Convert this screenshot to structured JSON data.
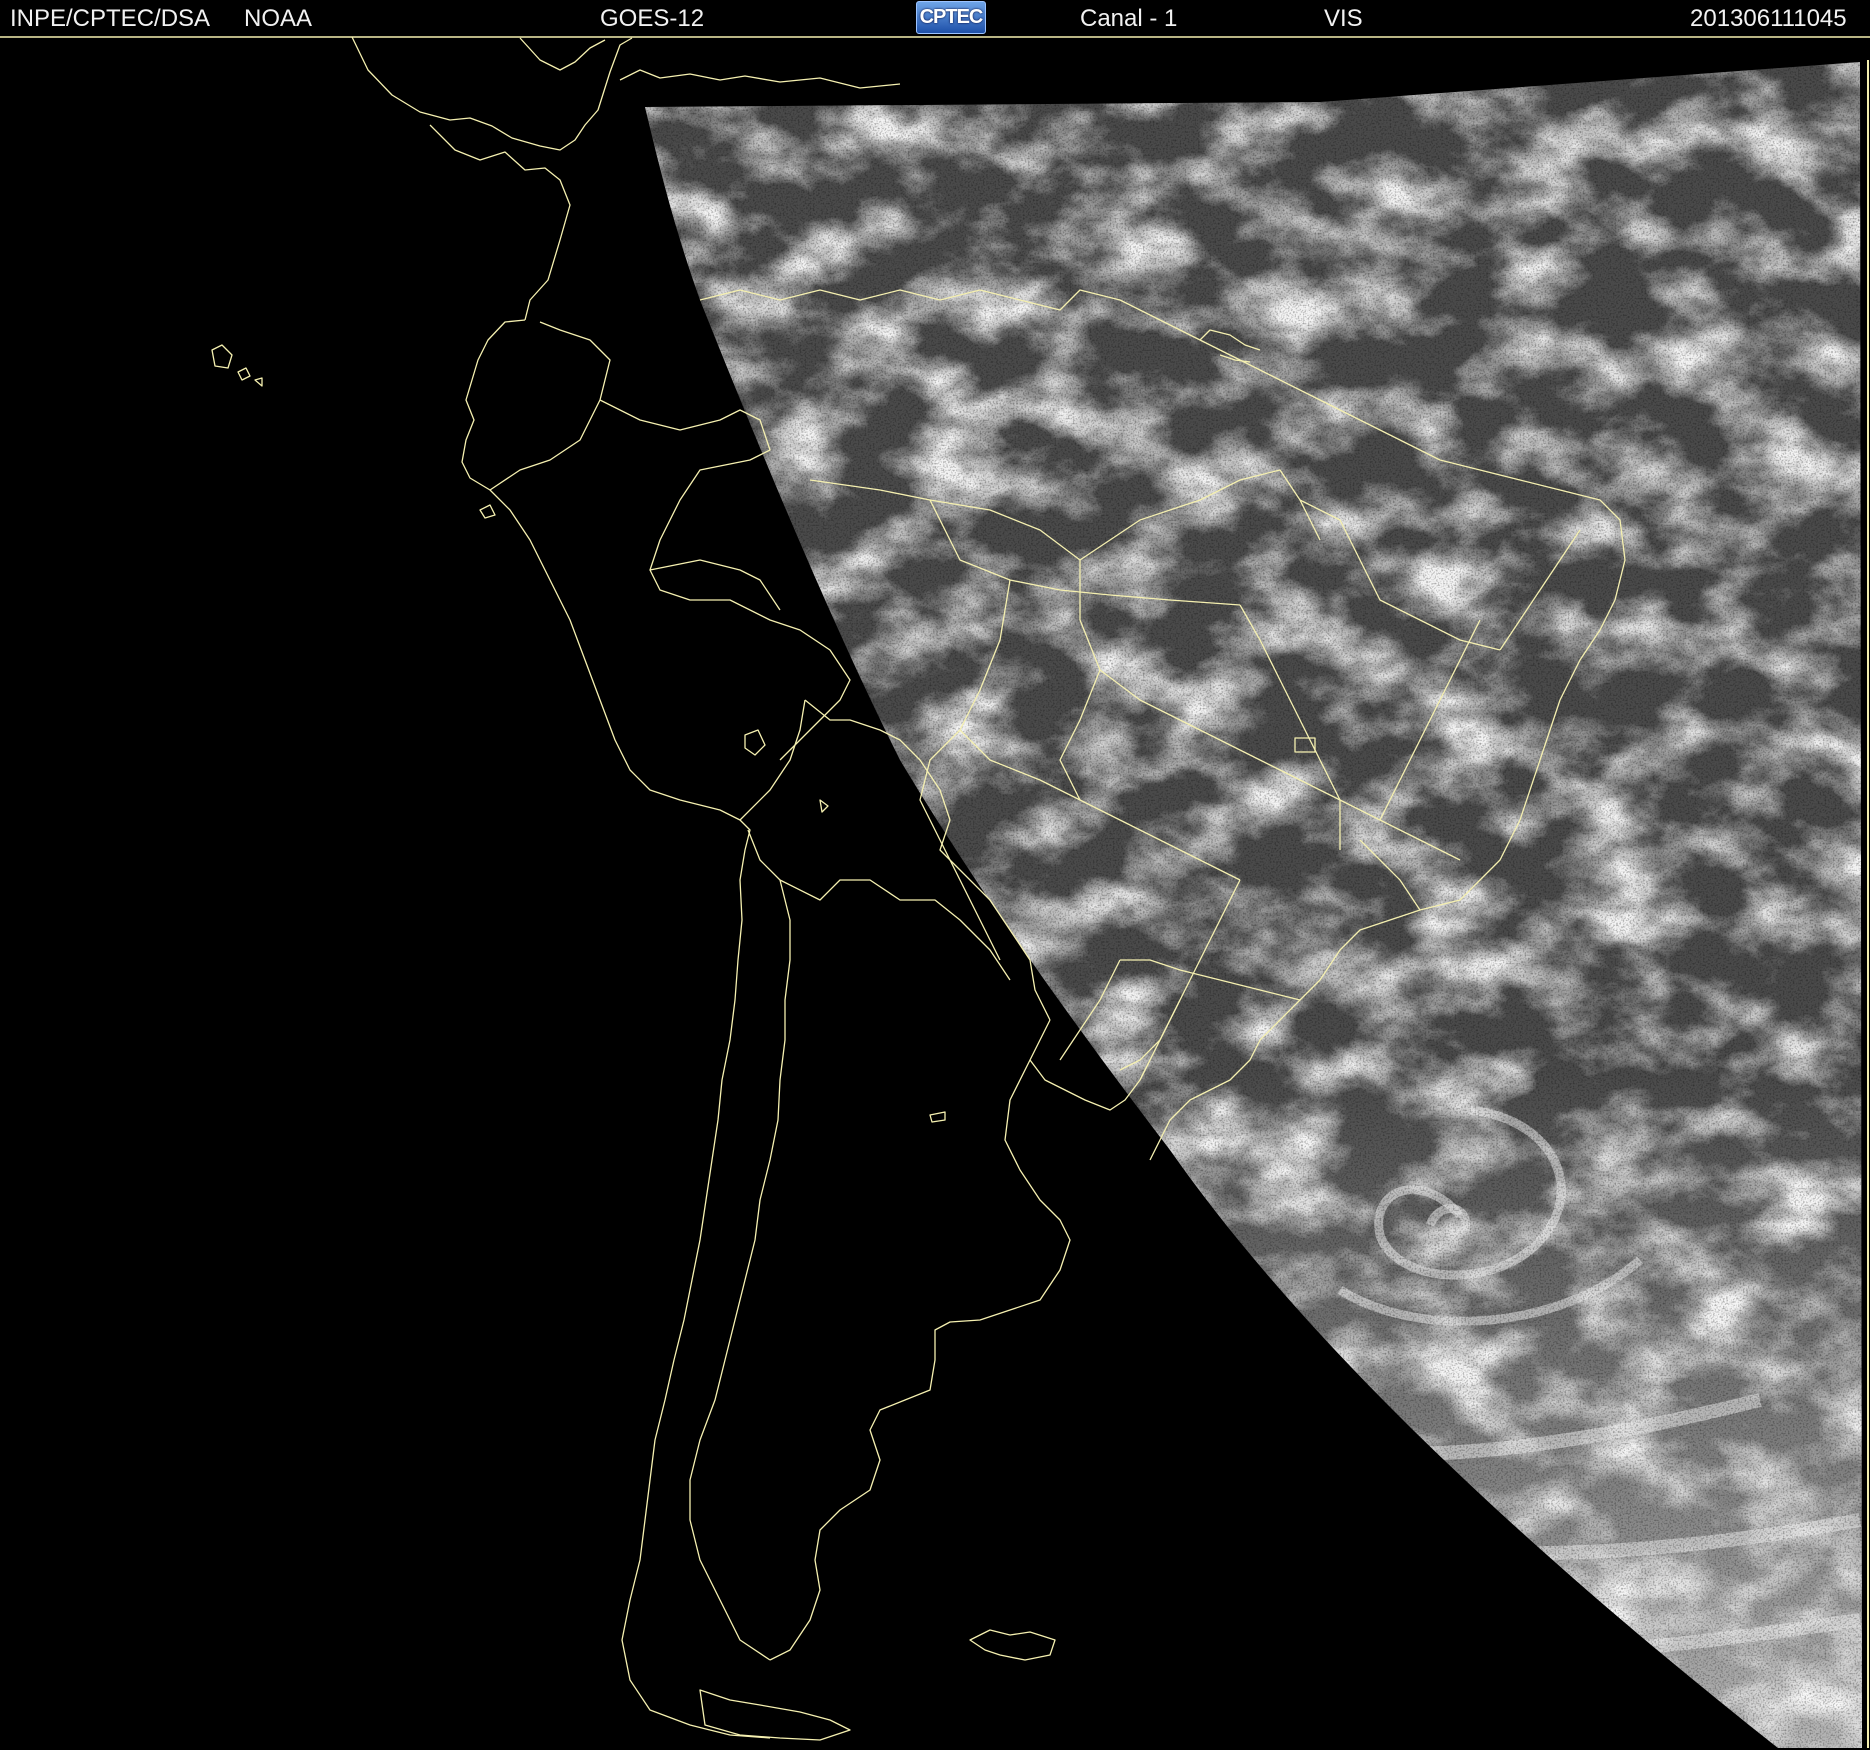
{
  "header": {
    "source": "INPE/CPTEC/DSA",
    "agency": "NOAA",
    "satellite": "GOES-12",
    "logo_text": "CPTEC",
    "channel": "Canal - 1",
    "band": "VIS",
    "timestamp": "201306111045"
  },
  "colors": {
    "background": "#000000",
    "header_text": "#f2f2f2",
    "borders": "#f5f0b0",
    "earth_base": "#4a4a4a",
    "cloud": "#e8e8e8"
  },
  "icons": {
    "logo": "cptec-logo-icon"
  }
}
